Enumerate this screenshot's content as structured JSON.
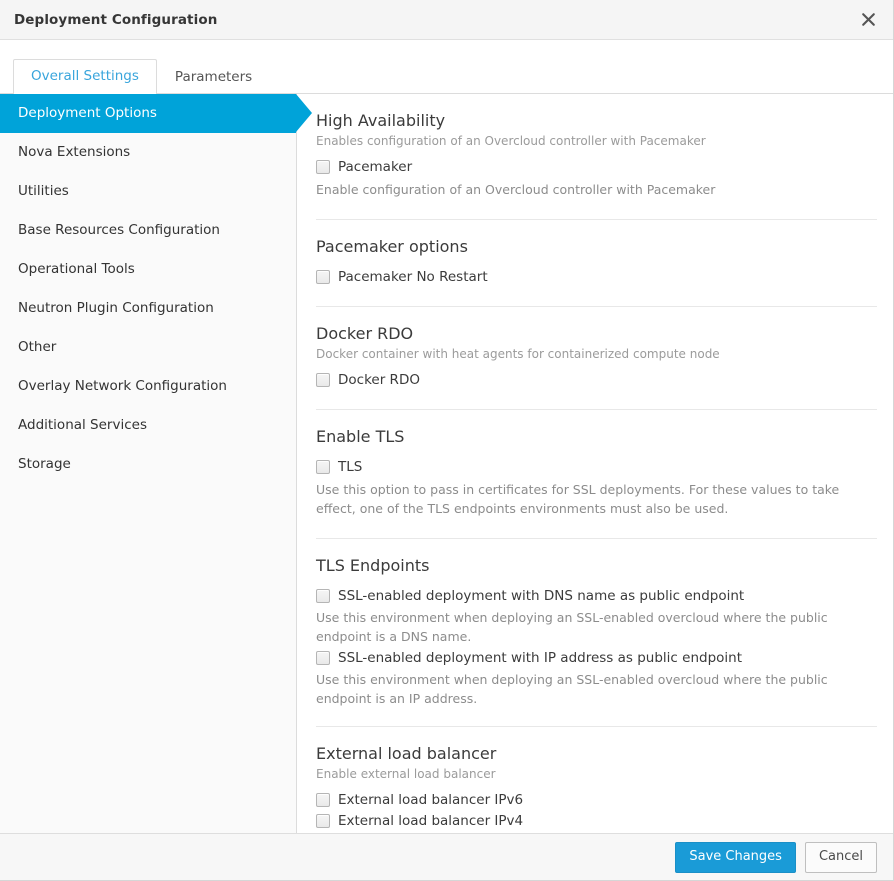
{
  "header": {
    "title": "Deployment Configuration",
    "close_icon": "close-icon"
  },
  "tabs": [
    {
      "label": "Overall Settings",
      "active": true
    },
    {
      "label": "Parameters",
      "active": false
    }
  ],
  "sidebar": {
    "items": [
      {
        "label": "Deployment Options",
        "active": true
      },
      {
        "label": "Nova Extensions",
        "active": false
      },
      {
        "label": "Utilities",
        "active": false
      },
      {
        "label": "Base Resources Configuration",
        "active": false
      },
      {
        "label": "Operational Tools",
        "active": false
      },
      {
        "label": "Neutron Plugin Configuration",
        "active": false
      },
      {
        "label": "Other",
        "active": false
      },
      {
        "label": "Overlay Network Configuration",
        "active": false
      },
      {
        "label": "Additional Services",
        "active": false
      },
      {
        "label": "Storage",
        "active": false
      }
    ]
  },
  "sections": [
    {
      "title": "High Availability",
      "subtitle": "Enables configuration of an Overcloud controller with Pacemaker",
      "checkboxes": [
        {
          "label": "Pacemaker",
          "checked": false
        }
      ],
      "help": "Enable configuration of an Overcloud controller with Pacemaker"
    },
    {
      "title": "Pacemaker options",
      "subtitle": "",
      "checkboxes": [
        {
          "label": "Pacemaker No Restart",
          "checked": false
        }
      ],
      "help": ""
    },
    {
      "title": "Docker RDO",
      "subtitle": "Docker container with heat agents for containerized compute node",
      "checkboxes": [
        {
          "label": "Docker RDO",
          "checked": false
        }
      ],
      "help": ""
    },
    {
      "title": "Enable TLS",
      "subtitle": "",
      "checkboxes": [
        {
          "label": "TLS",
          "checked": false
        }
      ],
      "help": "Use this option to pass in certificates for SSL deployments. For these values to take effect, one of the TLS endpoints environments must also be used."
    },
    {
      "title": "TLS Endpoints",
      "subtitle": "",
      "items": [
        {
          "label": "SSL-enabled deployment with DNS name as public endpoint",
          "checked": false,
          "help": "Use this environment when deploying an SSL-enabled overcloud where the public endpoint is a DNS name."
        },
        {
          "label": "SSL-enabled deployment with IP address as public endpoint",
          "checked": false,
          "help": "Use this environment when deploying an SSL-enabled overcloud where the public endpoint is an IP address."
        }
      ]
    },
    {
      "title": "External load balancer",
      "subtitle": "Enable external load balancer",
      "checkboxes": [
        {
          "label": "External load balancer IPv6",
          "checked": false
        },
        {
          "label": "External load balancer IPv4",
          "checked": false
        }
      ],
      "help": ""
    }
  ],
  "footer": {
    "save_label": "Save Changes",
    "cancel_label": "Cancel"
  },
  "colors": {
    "accent": "#00a3d9",
    "tab_active": "#39a5dc",
    "primary_button": "#1a9bd7",
    "header_bg": "#f5f5f5",
    "sidebar_bg": "#fafafa"
  }
}
